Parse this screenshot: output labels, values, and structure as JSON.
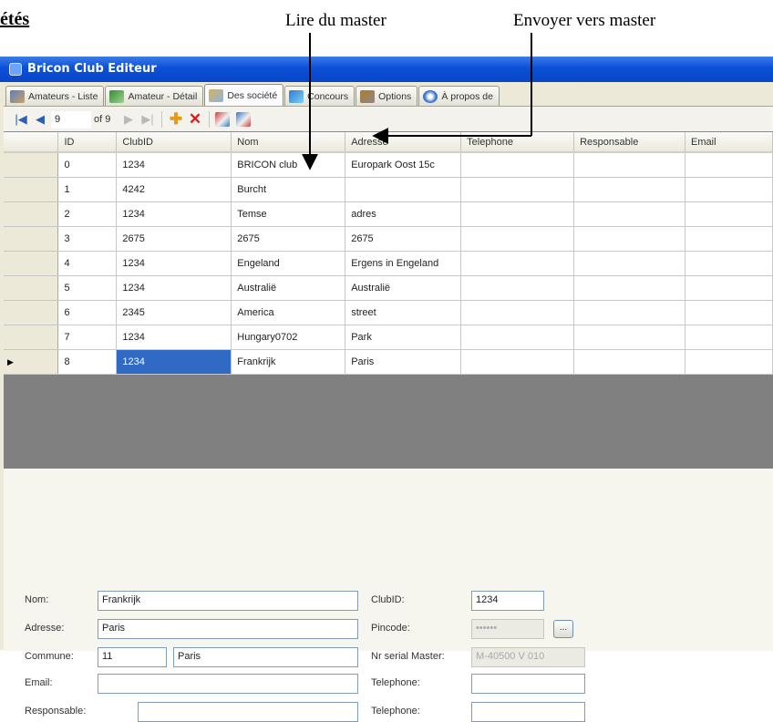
{
  "document": {
    "heading_fragment": "étés",
    "callout_read": "Lire du master",
    "callout_send": "Envoyer  vers  master"
  },
  "window": {
    "title": "Bricon Club Editeur"
  },
  "tabs": [
    {
      "label": "Amateurs - Liste",
      "icon": "people-icon"
    },
    {
      "label": "Amateur - Détail",
      "icon": "person-icon"
    },
    {
      "label": "Des société",
      "icon": "house-icon",
      "active": true
    },
    {
      "label": "Concours",
      "icon": "contest-icon"
    },
    {
      "label": "Options",
      "icon": "tools-icon"
    },
    {
      "label": "À propos de",
      "icon": "info-icon"
    }
  ],
  "toolbar": {
    "position_value": "9",
    "of_label": "of 9"
  },
  "grid": {
    "columns": [
      "ID",
      "ClubID",
      "Nom",
      "Adresse",
      "Telephone",
      "Responsable",
      "Email"
    ],
    "rows": [
      [
        "0",
        "1234",
        "BRICON club",
        "Europark Oost 15c",
        "",
        "",
        ""
      ],
      [
        "1",
        "4242",
        "Burcht",
        "",
        "",
        "",
        ""
      ],
      [
        "2",
        "1234",
        "Temse",
        "adres",
        "",
        "",
        ""
      ],
      [
        "3",
        "2675",
        " 2675",
        "2675",
        "",
        "",
        ""
      ],
      [
        "4",
        "1234",
        "Engeland",
        "Ergens in Engeland",
        "",
        "",
        ""
      ],
      [
        "5",
        "1234",
        "Australië",
        "Australië",
        "",
        "",
        ""
      ],
      [
        "6",
        "2345",
        "America",
        "street",
        "",
        "",
        ""
      ],
      [
        "7",
        "1234",
        "Hungary0702",
        "Park",
        "",
        "",
        ""
      ],
      [
        "8",
        "1234",
        "Frankrijk",
        "Paris",
        "",
        "",
        ""
      ]
    ],
    "current_row_marker": "▶"
  },
  "form": {
    "nom_label": "Nom:",
    "nom_value": "Frankrijk",
    "adresse_label": "Adresse:",
    "adresse_value": "Paris",
    "commune_label": "Commune:",
    "commune_code": "11",
    "commune_name": "Paris",
    "email_label": "Email:",
    "email_value": "",
    "responsable_label": "Responsable:",
    "responsable_value": "",
    "clubid_label": "ClubID:",
    "clubid_value": "1234",
    "pincode_label": "Pincode:",
    "pincode_value": "••••••",
    "pincode_button": "...",
    "serial_label": "Nr serial Master:",
    "serial_value": "M-40500 V 010",
    "telephone_label_1": "Telephone:",
    "telephone_value_1": "",
    "telephone_label_2": "Telephone:",
    "telephone_value_2": ""
  },
  "colors": {
    "titlebar": "#0a50d8",
    "selection": "#316ac5",
    "delete": "#e01c1c",
    "add": "#e79a17"
  }
}
